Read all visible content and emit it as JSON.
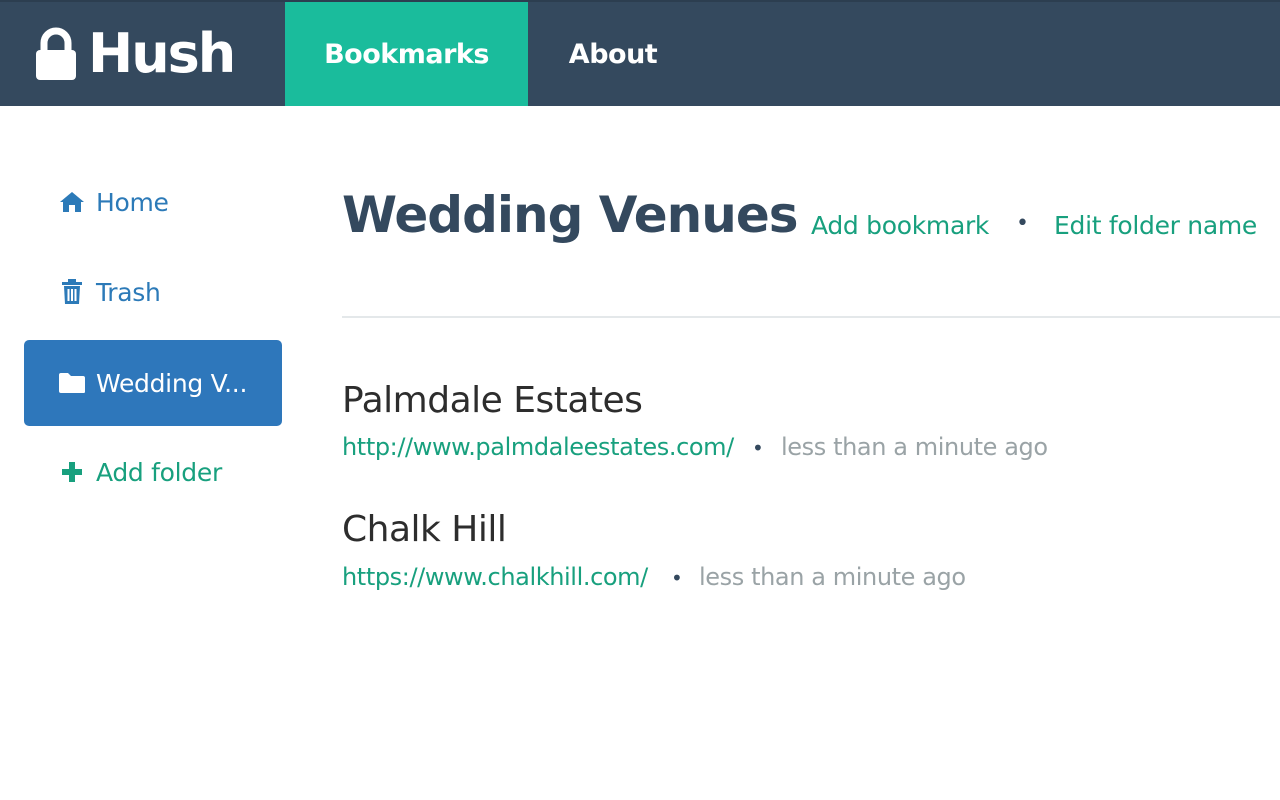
{
  "brand": {
    "name": "Hush",
    "icon": "lock-icon"
  },
  "nav": {
    "tabs": [
      {
        "label": "Bookmarks",
        "active": true
      },
      {
        "label": "About",
        "active": false
      }
    ]
  },
  "sidebar": {
    "items": [
      {
        "label": "Home",
        "icon": "home-icon"
      },
      {
        "label": "Trash",
        "icon": "trash-icon"
      },
      {
        "label": "Wedding V...",
        "icon": "folder-icon",
        "active": true
      },
      {
        "label": "Add folder",
        "icon": "plus-icon"
      }
    ]
  },
  "main": {
    "title": "Wedding Venues",
    "actions": {
      "add": "Add bookmark",
      "separator": "•",
      "edit": "Edit folder name"
    },
    "bookmarks": [
      {
        "title": "Palmdale Estates",
        "url": "http://www.palmdaleestates.com/",
        "separator": "•",
        "time": "less than a minute ago"
      },
      {
        "title": "Chalk Hill",
        "url": "https://www.chalkhill.com/",
        "separator": "•",
        "time": "less than a minute ago"
      }
    ]
  },
  "colors": {
    "navbar": "#34495e",
    "active_tab": "#1abc9c",
    "active_folder": "#2e77bb",
    "link_green": "#18a07e",
    "sidebar_link": "#2c7ab8",
    "muted": "#9aa3a6"
  }
}
